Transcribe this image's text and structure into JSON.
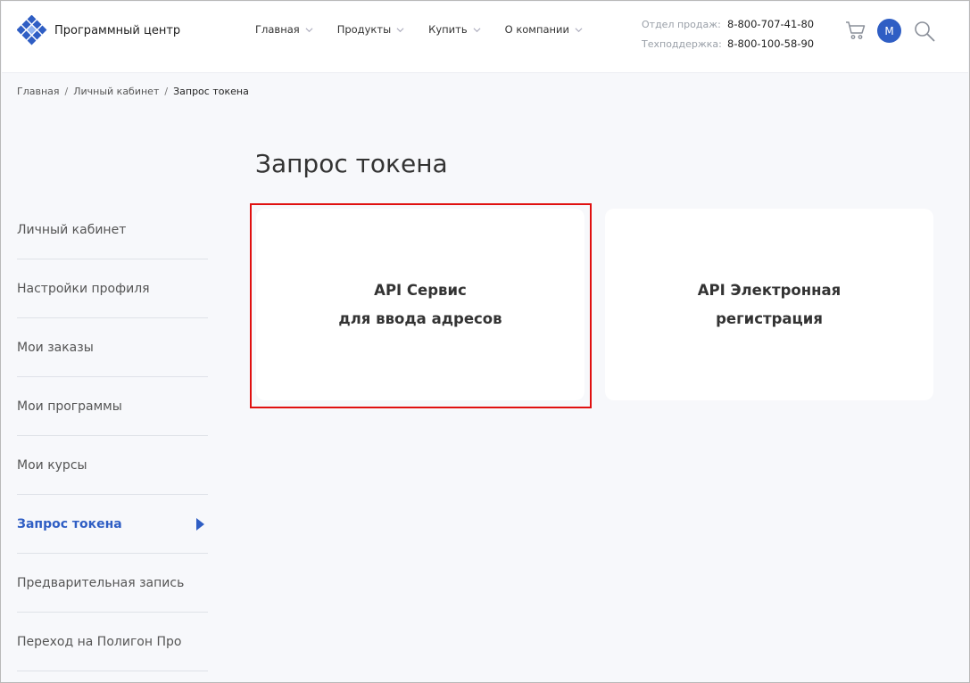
{
  "header": {
    "logo_text": "Программный центр",
    "nav": [
      {
        "label": "Главная"
      },
      {
        "label": "Продукты"
      },
      {
        "label": "Купить"
      },
      {
        "label": "О компании"
      }
    ],
    "contacts": [
      {
        "label": "Отдел продаж:",
        "phone": "8-800-707-41-80"
      },
      {
        "label": "Техподдержка:",
        "phone": "8-800-100-58-90"
      }
    ],
    "avatar_letter": "M",
    "icons": {
      "cart": "cart-icon",
      "search": "search-icon",
      "logo": "logo-icon",
      "chevron": "chevron-down-icon"
    },
    "accent_color": "#2f5ec4"
  },
  "breadcrumb": {
    "items": [
      "Главная",
      "Личный кабинет"
    ],
    "current": "Запрос токена"
  },
  "sidebar": {
    "items": [
      {
        "label": "Личный кабинет"
      },
      {
        "label": "Настройки профиля"
      },
      {
        "label": "Мои заказы"
      },
      {
        "label": "Мои программы"
      },
      {
        "label": "Мои курсы"
      },
      {
        "label": "Запрос токена",
        "active": true
      },
      {
        "label": "Предварительная запись"
      },
      {
        "label": "Переход на Полигон Про"
      }
    ]
  },
  "main": {
    "title": "Запрос токена",
    "cards": [
      {
        "line1": "API Сервис",
        "line2": "для ввода адресов",
        "highlighted": true
      },
      {
        "line1": "API Электронная",
        "line2": "регистрация"
      }
    ],
    "highlight_color": "#e01010"
  }
}
